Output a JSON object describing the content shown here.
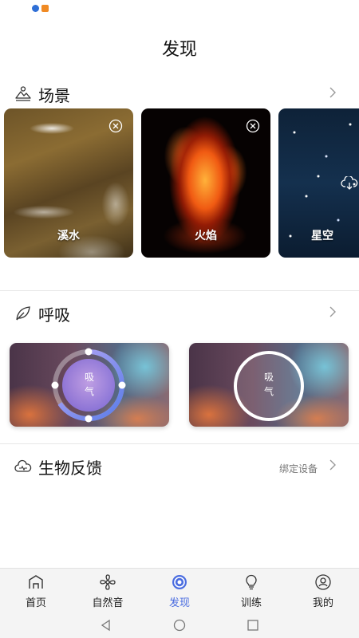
{
  "page": {
    "title": "发现"
  },
  "scenes": {
    "title": "场景",
    "cards": [
      {
        "label": "溪水",
        "action": "remove"
      },
      {
        "label": "火焰",
        "action": "remove"
      },
      {
        "label": "星空",
        "action": "download"
      }
    ]
  },
  "breath": {
    "title": "呼吸",
    "cards": [
      {
        "line1": "吸",
        "line2": "气"
      },
      {
        "line1": "吸",
        "line2": "气"
      }
    ]
  },
  "biofeedback": {
    "title": "生物反馈",
    "bind_device": "绑定设备"
  },
  "tabs": [
    {
      "label": "首页",
      "icon": "home-icon",
      "active": false
    },
    {
      "label": "自然音",
      "icon": "fan-icon",
      "active": false
    },
    {
      "label": "发现",
      "icon": "discover-icon",
      "active": true
    },
    {
      "label": "训练",
      "icon": "bulb-icon",
      "active": false
    },
    {
      "label": "我的",
      "icon": "profile-icon",
      "active": false
    }
  ],
  "colors": {
    "accent": "#4b6de0",
    "tab_bar_bg": "#f4f4f4"
  }
}
